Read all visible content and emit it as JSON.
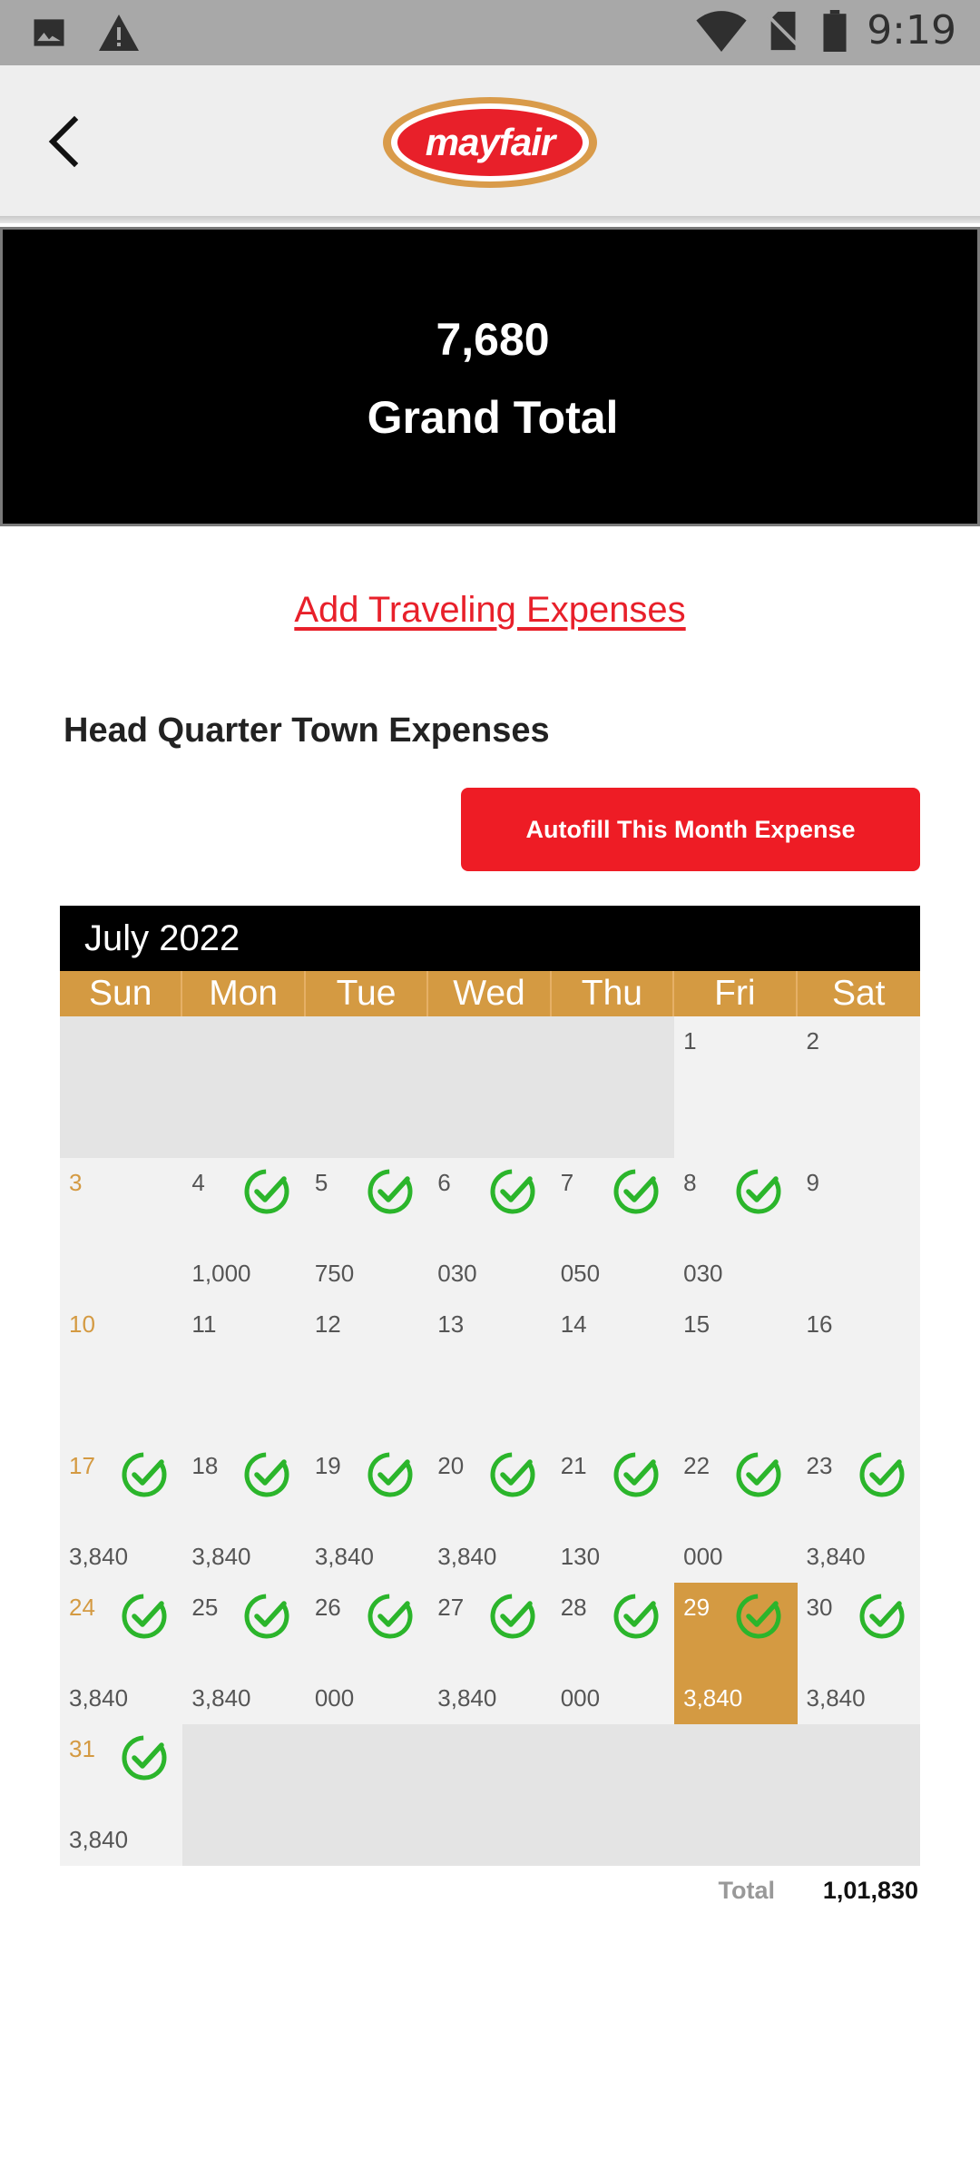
{
  "status_bar": {
    "time": "9:19",
    "left_icons": [
      "image-icon",
      "warning-icon"
    ],
    "right_icons": [
      "wifi-icon",
      "no-sim-icon",
      "battery-icon"
    ]
  },
  "app_bar": {
    "logo_text": "mayfair",
    "back_icon": "back-arrow-icon"
  },
  "grand_total": {
    "value": "7,680",
    "label": "Grand Total"
  },
  "add_traveling_link": "Add Traveling Expenses",
  "section_title": "Head Quarter Town Expenses",
  "autofill_button": "Autofill This Month Expense",
  "colors": {
    "accent_red": "#ee1c25",
    "accent_gold": "#d49a42",
    "check_green": "#2bb52b"
  },
  "calendar": {
    "month_label": "July 2022",
    "weekdays": [
      "Sun",
      "Mon",
      "Tue",
      "Wed",
      "Thu",
      "Fri",
      "Sat"
    ],
    "leading_empty": 5,
    "selected_day": 29,
    "days": [
      {
        "day": "1",
        "amount": "",
        "checked": false
      },
      {
        "day": "2",
        "amount": "",
        "checked": false
      },
      {
        "day": "3",
        "amount": "",
        "checked": false
      },
      {
        "day": "4",
        "amount": "1,000",
        "checked": true
      },
      {
        "day": "5",
        "amount": "750",
        "checked": true
      },
      {
        "day": "6",
        "amount": "030",
        "checked": true
      },
      {
        "day": "7",
        "amount": "050",
        "checked": true
      },
      {
        "day": "8",
        "amount": "030",
        "checked": true
      },
      {
        "day": "9",
        "amount": "",
        "checked": false
      },
      {
        "day": "10",
        "amount": "",
        "checked": false
      },
      {
        "day": "11",
        "amount": "",
        "checked": false
      },
      {
        "day": "12",
        "amount": "",
        "checked": false
      },
      {
        "day": "13",
        "amount": "",
        "checked": false
      },
      {
        "day": "14",
        "amount": "",
        "checked": false
      },
      {
        "day": "15",
        "amount": "",
        "checked": false
      },
      {
        "day": "16",
        "amount": "",
        "checked": false
      },
      {
        "day": "17",
        "amount": "3,840",
        "checked": true
      },
      {
        "day": "18",
        "amount": "3,840",
        "checked": true
      },
      {
        "day": "19",
        "amount": "3,840",
        "checked": true
      },
      {
        "day": "20",
        "amount": "3,840",
        "checked": true
      },
      {
        "day": "21",
        "amount": "130",
        "checked": true
      },
      {
        "day": "22",
        "amount": "000",
        "checked": true
      },
      {
        "day": "23",
        "amount": "3,840",
        "checked": true
      },
      {
        "day": "24",
        "amount": "3,840",
        "checked": true
      },
      {
        "day": "25",
        "amount": "3,840",
        "checked": true
      },
      {
        "day": "26",
        "amount": "000",
        "checked": true
      },
      {
        "day": "27",
        "amount": "3,840",
        "checked": true
      },
      {
        "day": "28",
        "amount": "000",
        "checked": true
      },
      {
        "day": "29",
        "amount": "3,840",
        "checked": true
      },
      {
        "day": "30",
        "amount": "3,840",
        "checked": true
      },
      {
        "day": "31",
        "amount": "3,840",
        "checked": true
      }
    ],
    "trailing_empty": 6
  },
  "total_row": {
    "label": "Total",
    "value": "1,01,830"
  }
}
